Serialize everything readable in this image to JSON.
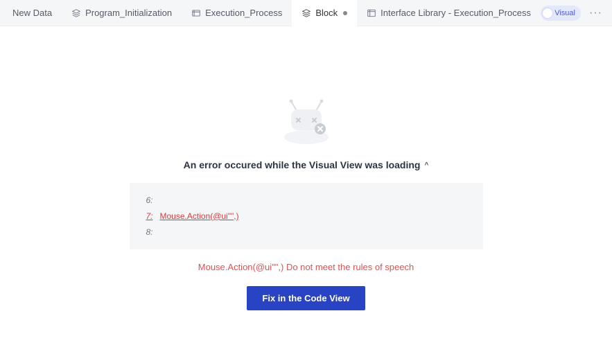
{
  "tabs": [
    {
      "icon": "",
      "label": "New Data"
    },
    {
      "icon": "stack",
      "label": "Program_Initialization"
    },
    {
      "icon": "process",
      "label": "Execution_Process"
    },
    {
      "icon": "stack",
      "label": "Block",
      "dirty": true,
      "active": true
    },
    {
      "icon": "library",
      "label": "Interface Library - Execution_Process"
    }
  ],
  "mode_label": "Visual",
  "more_label": "···",
  "error": {
    "title": "An error occured while the Visual View was loading",
    "caret": "^",
    "lines": [
      {
        "num": "6:",
        "code": ""
      },
      {
        "num": "7:",
        "code": "Mouse.Action(@ui\"\",)",
        "err": true
      },
      {
        "num": "8:",
        "code": ""
      }
    ],
    "detail": "Mouse.Action(@ui\"\",) Do not meet the rules of speech",
    "button": "Fix in the Code View"
  }
}
